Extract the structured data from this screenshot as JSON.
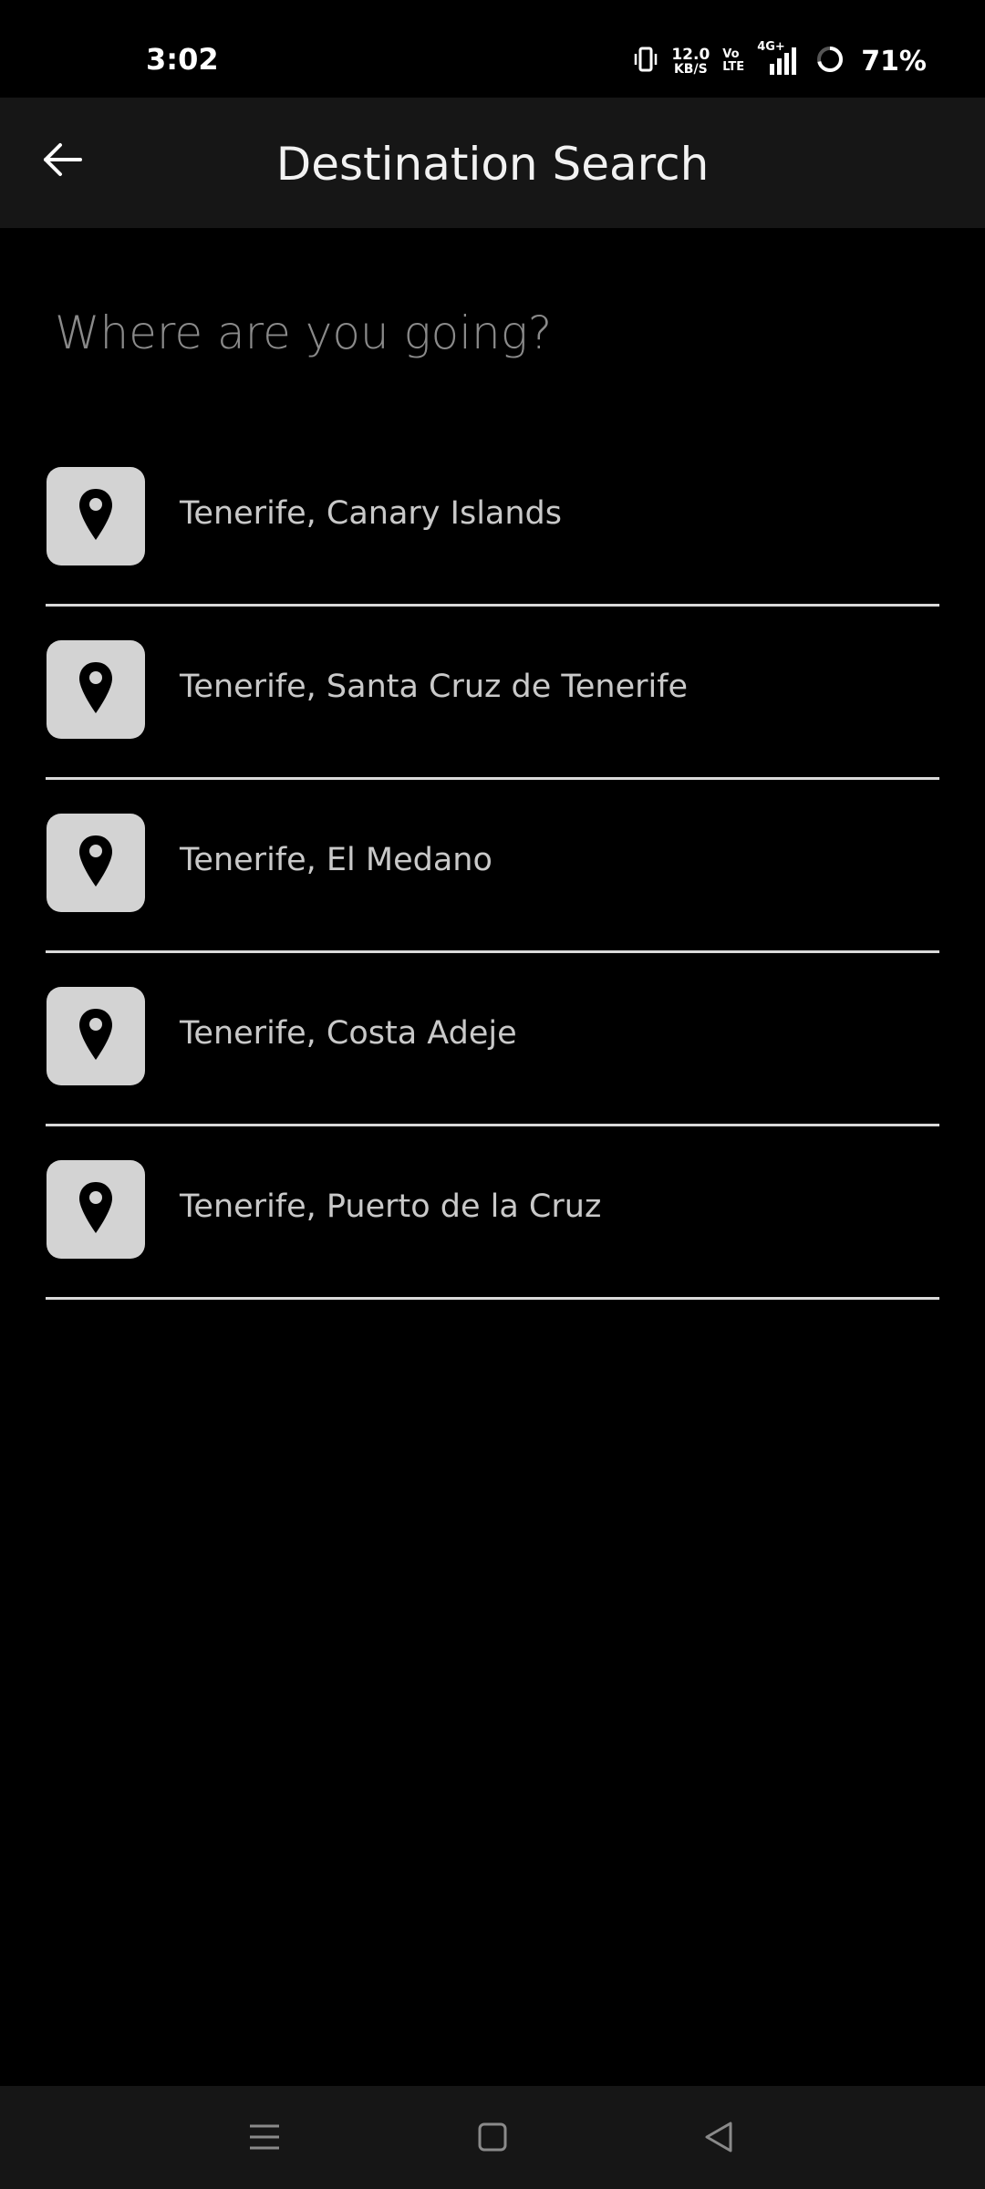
{
  "status_bar": {
    "time": "3:02",
    "net_speed_value": "12.0",
    "net_speed_unit": "KB/S",
    "volte_top": "Vo",
    "volte_bottom": "LTE",
    "network": "4G+",
    "battery": "71%",
    "icons": [
      "vibrate-icon",
      "signal-icon",
      "battery-ring-icon"
    ]
  },
  "app_bar": {
    "title": "Destination Search",
    "back_icon": "arrow-left-icon"
  },
  "search": {
    "value": "",
    "placeholder": "Where are you going?"
  },
  "results": [
    {
      "label": "Tenerife, Canary Islands",
      "icon": "map-pin-icon"
    },
    {
      "label": "Tenerife, Santa Cruz de Tenerife",
      "icon": "map-pin-icon"
    },
    {
      "label": "Tenerife, El Medano",
      "icon": "map-pin-icon"
    },
    {
      "label": "Tenerife, Costa Adeje",
      "icon": "map-pin-icon"
    },
    {
      "label": "Tenerife, Puerto de la Cruz",
      "icon": "map-pin-icon"
    }
  ],
  "nav_bar": {
    "buttons": [
      "menu-icon",
      "home-square-icon",
      "back-triangle-icon"
    ]
  },
  "colors": {
    "background": "#000000",
    "app_bar": "#161616",
    "icon_box": "#d3d3d3",
    "divider": "#d9d9d9",
    "result_text": "#c9c9c9",
    "placeholder": "#8a8a8a"
  }
}
